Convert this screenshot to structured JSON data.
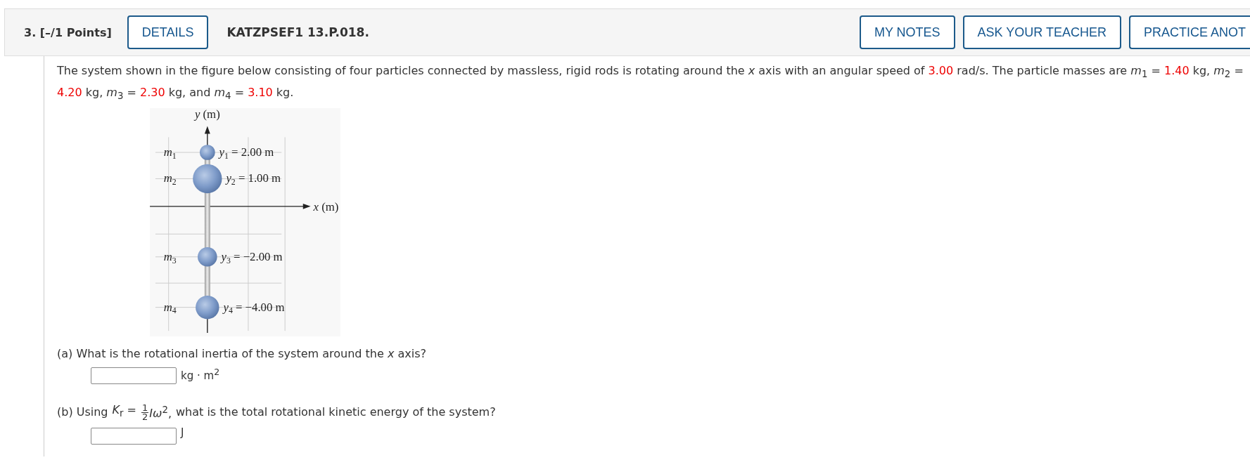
{
  "header": {
    "points": "3. [–/1 Points]",
    "details_button": "DETAILS",
    "problem_id": "KATZPSEF1 13.P.018.",
    "actions": [
      "MY NOTES",
      "ASK YOUR TEACHER",
      "PRACTICE ANOT"
    ]
  },
  "problem": [
    {
      "text": "The system shown in the figure below consisting of four particles connected by massless, rigid rods is rotating around the *x* axis with an angular speed of ",
      "highlight": false
    },
    {
      "text": "3.00",
      "highlight": true
    },
    {
      "text": " rad/s. The particle masses are  *m*$_{1}$ = ",
      "highlight": false
    },
    {
      "text": "1.40",
      "highlight": true
    },
    {
      "text": " kg,  *m*$_{2}$ = ",
      "highlight": false
    },
    {
      "text": "4.20",
      "highlight": true
    },
    {
      "text": " kg,  *m*$_{3}$ = ",
      "highlight": false
    },
    {
      "text": "2.30",
      "highlight": true
    },
    {
      "text": " kg,  and  *m*$_{4}$ = ",
      "highlight": false
    },
    {
      "text": "3.10",
      "highlight": true
    },
    {
      "text": " kg.",
      "highlight": false
    }
  ],
  "figure": {
    "y_axis": "y (m)",
    "x_axis": "x (m)",
    "particles": [
      {
        "symbol": "m",
        "index": "1",
        "coord_symbol": "y",
        "coord_index": "1",
        "coord_value": "= 2.00 m"
      },
      {
        "symbol": "m",
        "index": "2",
        "coord_symbol": "y",
        "coord_index": "2",
        "coord_value": "= 1.00 m"
      },
      {
        "symbol": "m",
        "index": "3",
        "coord_symbol": "y",
        "coord_index": "3",
        "coord_value": "= −2.00 m"
      },
      {
        "symbol": "m",
        "index": "4",
        "coord_symbol": "y",
        "coord_index": "4",
        "coord_value": "= −4.00 m"
      }
    ]
  },
  "parts": [
    {
      "kind": "plain",
      "question": "(a) What is the rotational inertia of the system around the *x* axis?",
      "unit": "kg · m$^{2}$"
    },
    {
      "kind": "formula",
      "lead": "(b) Using",
      "formula": "*K*$_{r}$ =",
      "numerator": "1",
      "denominator": "2",
      "after": "*Iω*$^{2}$,",
      "question": "what is the total rotational kinetic energy of the system?",
      "unit": "J"
    }
  ]
}
